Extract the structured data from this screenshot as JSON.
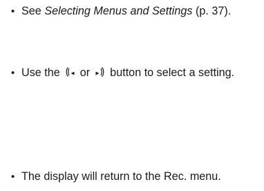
{
  "items": [
    {
      "bullet": "•",
      "prefix": "See ",
      "emphasis": "Selecting Menus and Settings",
      "suffix": " (p. 37)."
    },
    {
      "bullet": "•",
      "prefix": "Use the ",
      "left_icon": "left-arrow-button-icon",
      "middle": " or ",
      "right_icon": "right-arrow-button-icon",
      "suffix": " button to select a setting."
    },
    {
      "bullet": "•",
      "text": "The display will return to the Rec. menu."
    }
  ]
}
